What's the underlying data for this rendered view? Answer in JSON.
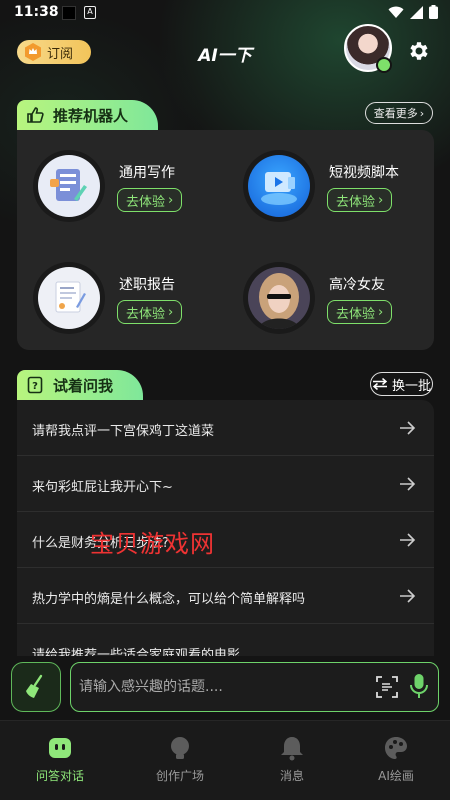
{
  "status_bar": {
    "time": "11:38",
    "app_icon_letter": "A"
  },
  "header": {
    "subscribe_label": "订阅",
    "title": "AI一下",
    "settings_icon": "gear-icon",
    "avatar_icon": "user-avatar"
  },
  "recommended": {
    "section_title": "推荐机器人",
    "more_label": "查看更多",
    "try_label": "去体验",
    "bots": [
      {
        "name": "通用写作",
        "icon": "writing-doc-icon"
      },
      {
        "name": "短视频脚本",
        "icon": "video-script-icon"
      },
      {
        "name": "述职报告",
        "icon": "report-icon"
      },
      {
        "name": "高冷女友",
        "icon": "girlfriend-avatar"
      }
    ]
  },
  "try_asking": {
    "section_title": "试着问我",
    "refresh_label": "换一批",
    "questions": [
      "请帮我点评一下宫保鸡丁这道菜",
      "来句彩虹屁让我开心下~",
      "什么是财务分析三步法?",
      "热力学中的熵是什么概念，可以给个简单解释吗",
      "请给我推荐一些适合家庭观看的电影"
    ]
  },
  "watermark": "宝贝游戏网",
  "input": {
    "placeholder": "请输入感兴趣的话题...."
  },
  "bottom_nav": {
    "items": [
      {
        "label": "问答对话",
        "icon": "chat-bot-icon",
        "active": true
      },
      {
        "label": "创作广场",
        "icon": "lightbulb-icon",
        "active": false
      },
      {
        "label": "消息",
        "icon": "bell-icon",
        "active": false
      },
      {
        "label": "AI绘画",
        "icon": "palette-icon",
        "active": false
      }
    ]
  },
  "colors": {
    "accent_green": "#7ee06a",
    "gold": "#f2c45a",
    "background": "#141414"
  }
}
